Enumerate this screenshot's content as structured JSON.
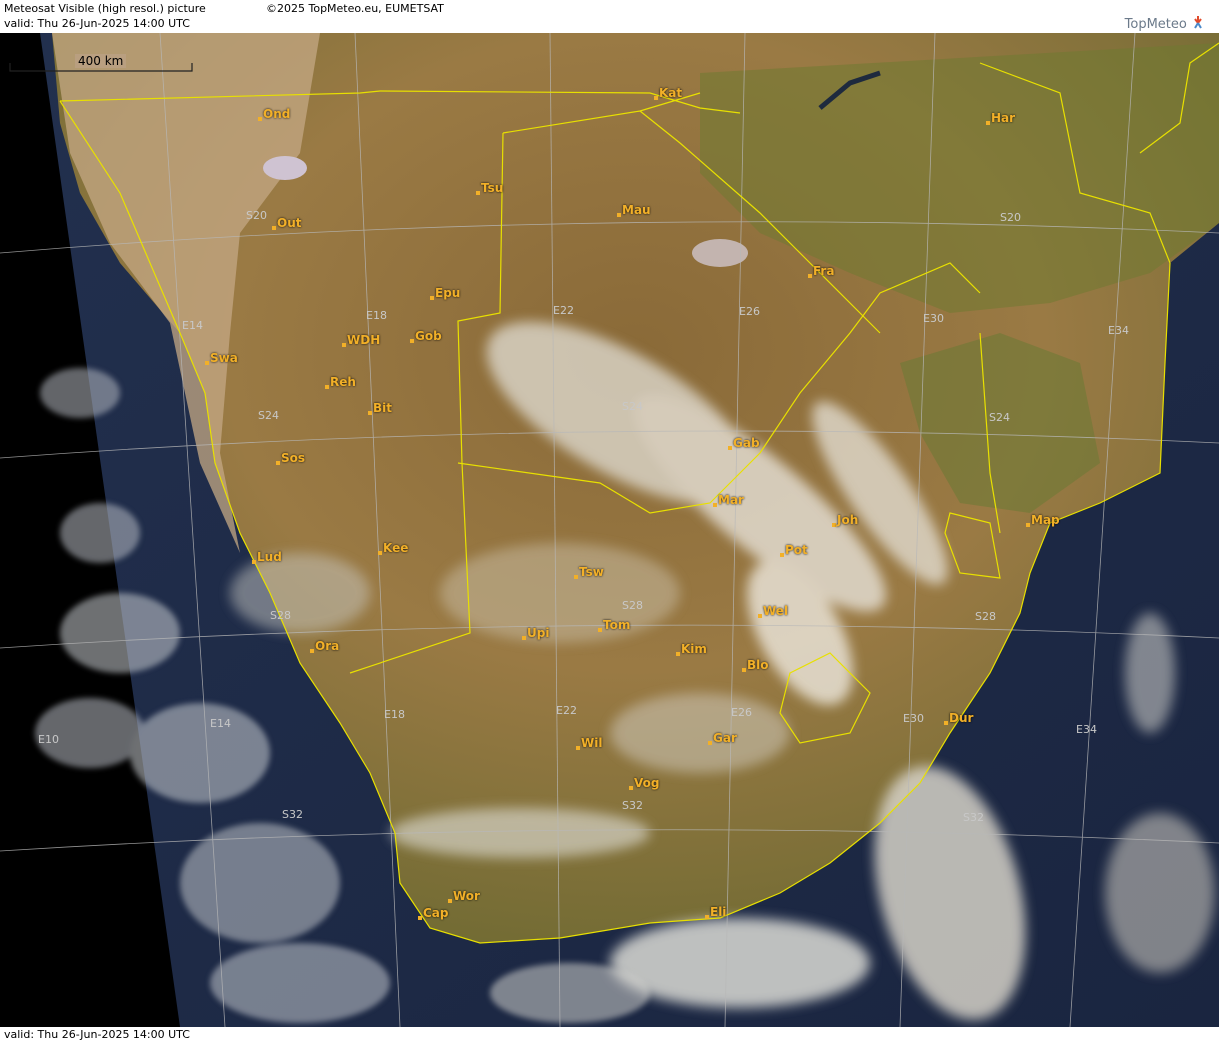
{
  "header": {
    "title": "Meteosat Visible (high resol.) picture",
    "copyright": "©2025 TopMeteo.eu, EUMETSAT",
    "valid": "valid:  Thu  26-Jun-2025  14:00 UTC",
    "logo": "TopMeteo"
  },
  "footer": {
    "valid": "valid:  Thu  26-Jun-2025  14:00 UTC"
  },
  "scale": {
    "label": "400 km"
  },
  "cities": [
    {
      "code": "Kat"
    },
    {
      "code": "Har"
    },
    {
      "code": "Ond"
    },
    {
      "code": "Tsu"
    },
    {
      "code": "Mau"
    },
    {
      "code": "Out"
    },
    {
      "code": "Fra"
    },
    {
      "code": "Epu"
    },
    {
      "code": "Gob"
    },
    {
      "code": "WDH"
    },
    {
      "code": "Swa"
    },
    {
      "code": "Reh"
    },
    {
      "code": "Bit"
    },
    {
      "code": "Gab"
    },
    {
      "code": "Sos"
    },
    {
      "code": "Mar"
    },
    {
      "code": "Joh"
    },
    {
      "code": "Map"
    },
    {
      "code": "Pot"
    },
    {
      "code": "Kee"
    },
    {
      "code": "Lud"
    },
    {
      "code": "Tsw"
    },
    {
      "code": "Wel"
    },
    {
      "code": "Upi"
    },
    {
      "code": "Tom"
    },
    {
      "code": "Kim"
    },
    {
      "code": "Ora"
    },
    {
      "code": "Blo"
    },
    {
      "code": "Dur"
    },
    {
      "code": "Wil"
    },
    {
      "code": "Gar"
    },
    {
      "code": "Vog"
    },
    {
      "code": "Wor"
    },
    {
      "code": "Cap"
    },
    {
      "code": "Eli"
    }
  ],
  "grid_labels": [
    {
      "text": "S20"
    },
    {
      "text": "S20"
    },
    {
      "text": "E14"
    },
    {
      "text": "E18"
    },
    {
      "text": "E22"
    },
    {
      "text": "E26"
    },
    {
      "text": "E30"
    },
    {
      "text": "E34"
    },
    {
      "text": "S24"
    },
    {
      "text": "S24"
    },
    {
      "text": "S24"
    },
    {
      "text": "S28"
    },
    {
      "text": "S28"
    },
    {
      "text": "S28"
    },
    {
      "text": "E10"
    },
    {
      "text": "E14"
    },
    {
      "text": "E18"
    },
    {
      "text": "E22"
    },
    {
      "text": "E26"
    },
    {
      "text": "E30"
    },
    {
      "text": "E34"
    },
    {
      "text": "S32"
    },
    {
      "text": "S32"
    },
    {
      "text": "S32"
    }
  ],
  "colors": {
    "label": "#f2b028",
    "border": "#e8e000",
    "grid": "#b8b8b8",
    "ocean": "#1f2a44"
  }
}
